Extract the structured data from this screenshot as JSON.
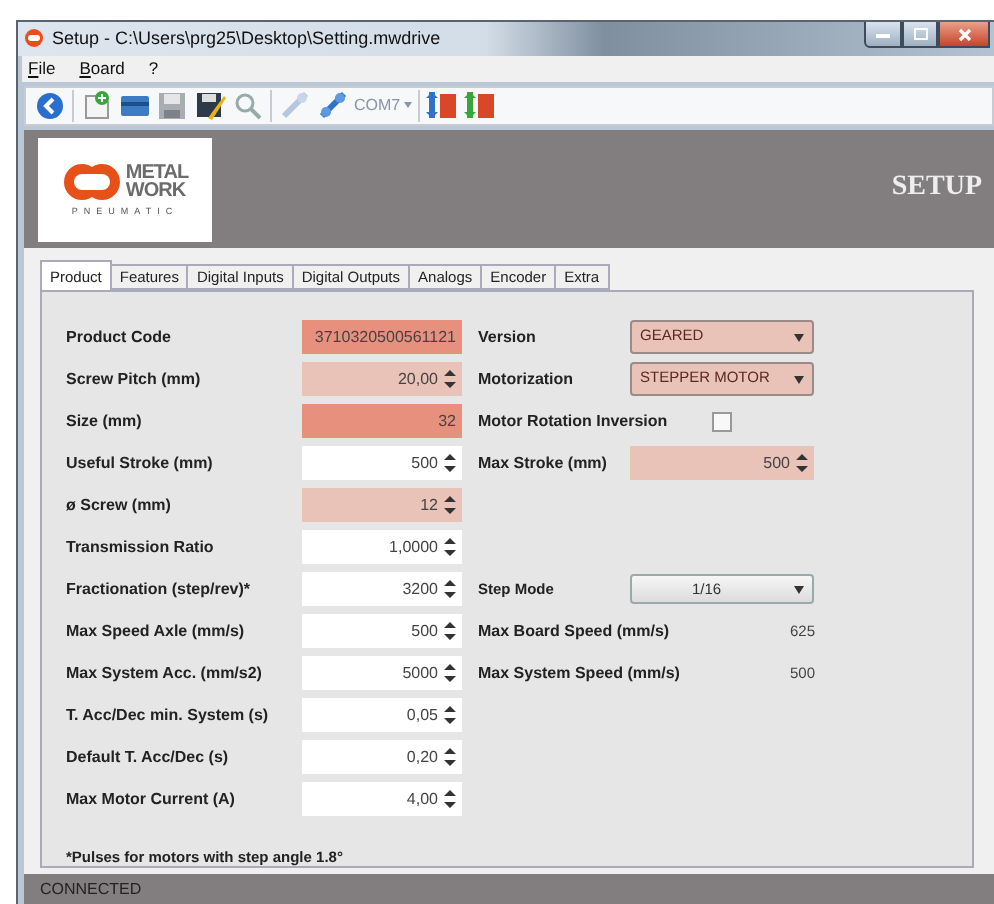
{
  "window": {
    "title": "Setup - C:\\Users\\prg25\\Desktop\\Setting.mwdrive"
  },
  "menu": [
    {
      "label": "File",
      "mnemonic": true
    },
    {
      "label": "Board",
      "mnemonic": true
    },
    {
      "label": "?"
    }
  ],
  "toolbar": {
    "port": "COM7"
  },
  "logo": {
    "line1": "METAL",
    "line2": "WORK",
    "tagline": "PNEUMATIC"
  },
  "header": {
    "title": "SETUP"
  },
  "tabs": [
    {
      "label": "Product",
      "selected": true
    },
    {
      "label": "Features",
      "selected": false
    },
    {
      "label": "Digital Inputs",
      "selected": false
    },
    {
      "label": "Digital Outputs",
      "selected": false
    },
    {
      "label": "Analogs",
      "selected": false
    },
    {
      "label": "Encoder",
      "selected": false
    },
    {
      "label": "Extra",
      "selected": false
    }
  ],
  "rows": [
    {
      "left": {
        "label": "Product Code",
        "kind": "text",
        "color": "#e8907e",
        "value": "3710320500561121"
      },
      "right": {
        "label": "Version",
        "kind": "combo",
        "color": "#e9c3b8",
        "value": "GEARED"
      }
    },
    {
      "left": {
        "label": "Screw Pitch (mm)",
        "kind": "spin",
        "color": "#e9c3b8",
        "value": "20,00"
      },
      "right": {
        "label": "Motorization",
        "kind": "combo",
        "color": "#e9c3b8",
        "value": "STEPPER MOTOR"
      }
    },
    {
      "left": {
        "label": "Size (mm)",
        "kind": "text",
        "color": "#e8907e",
        "value": "32"
      },
      "right": {
        "label": "Motor Rotation Inversion",
        "kind": "checkbox",
        "checked": false
      }
    },
    {
      "left": {
        "label": "Useful Stroke (mm)",
        "kind": "spin",
        "color": "#ffffff",
        "value": "500"
      },
      "right": {
        "label": "Max Stroke (mm)",
        "kind": "spin",
        "color": "#e9c3b8",
        "value": "500"
      }
    },
    {
      "left": {
        "label": "ø Screw (mm)",
        "kind": "spin",
        "color": "#e9c3b8",
        "value": "12"
      }
    },
    {
      "left": {
        "label": "Transmission Ratio",
        "kind": "spin",
        "color": "#ffffff",
        "value": "1,0000"
      }
    },
    {
      "left": {
        "label": "Fractionation (step/rev)*",
        "kind": "spin",
        "color": "#ffffff",
        "value": "3200"
      },
      "right": {
        "label": "Step Mode",
        "kind": "button-combo",
        "value": "1/16"
      }
    },
    {
      "left": {
        "label": "Max Speed Axle (mm/s)",
        "kind": "spin",
        "color": "#ffffff",
        "value": "500"
      },
      "right": {
        "label": "Max Board Speed (mm/s)",
        "kind": "value",
        "value": "625"
      }
    },
    {
      "left": {
        "label": "Max System Acc. (mm/s2)",
        "kind": "spin",
        "color": "#ffffff",
        "value": "5000"
      },
      "right": {
        "label": "Max System Speed (mm/s)",
        "kind": "value",
        "value": "500"
      }
    },
    {
      "left": {
        "label": "T. Acc/Dec min. System (s)",
        "kind": "spin",
        "color": "#ffffff",
        "value": "0,05"
      }
    },
    {
      "left": {
        "label": "Default T. Acc/Dec (s)",
        "kind": "spin",
        "color": "#ffffff",
        "value": "0,20"
      }
    },
    {
      "left": {
        "label": "Max Motor Current (A)",
        "kind": "spin",
        "color": "#ffffff",
        "value": "4,00"
      }
    }
  ],
  "note": "*Pulses for motors with step angle 1.8°",
  "status_bar": {
    "text": "CONNECTED"
  }
}
